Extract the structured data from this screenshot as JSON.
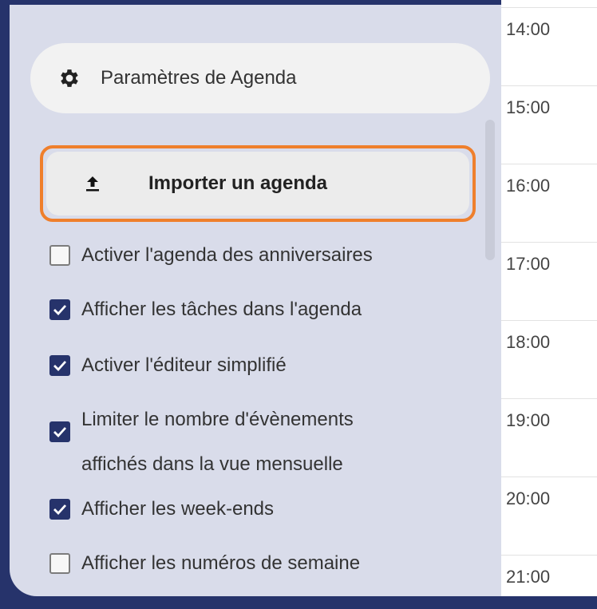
{
  "sidebar": {
    "settings_button": {
      "label": "Paramètres de Agenda",
      "icon": "gear-icon"
    },
    "import_button": {
      "label": "Importer un agenda",
      "icon": "upload-icon",
      "highlight_color": "#ef7f2c"
    },
    "options": [
      {
        "label": "Activer l'agenda des anniversaires",
        "checked": false
      },
      {
        "label": "Afficher les tâches dans l'agenda",
        "checked": true
      },
      {
        "label": "Activer l'éditeur simplifié",
        "checked": true
      },
      {
        "label_line1": "Limiter le nombre d'évènements",
        "label_line2": "affichés dans la vue mensuelle",
        "checked": true
      },
      {
        "label": "Afficher les week-ends",
        "checked": true
      },
      {
        "label": "Afficher les numéros de semaine",
        "checked": false
      }
    ]
  },
  "timeline": {
    "hours": [
      "14:00",
      "15:00",
      "16:00",
      "17:00",
      "18:00",
      "19:00",
      "20:00",
      "21:00"
    ]
  },
  "colors": {
    "accent": "#26336b",
    "panel": "#d9dcea",
    "highlight": "#ef7f2c"
  }
}
